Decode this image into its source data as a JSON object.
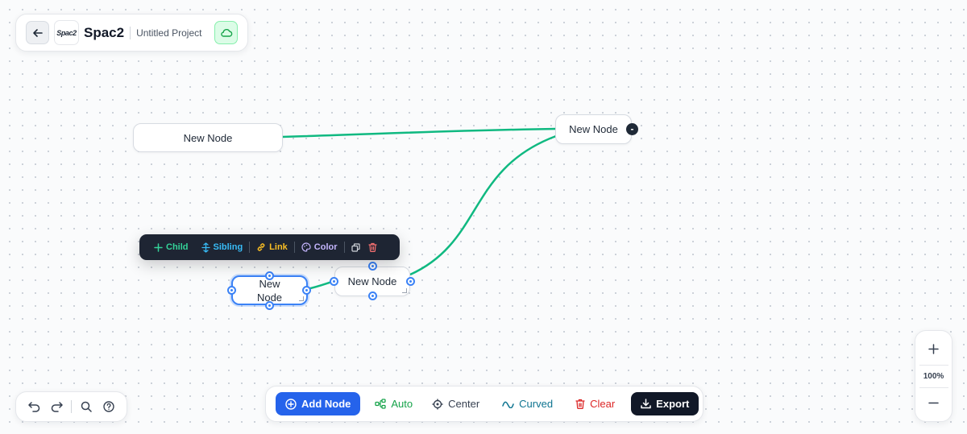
{
  "header": {
    "back_icon": "arrow-left-icon",
    "logo_text": "Spac2",
    "app_name": "Spac2",
    "project_name": "Untitled Project",
    "cloud_icon": "cloud-icon"
  },
  "nodes": [
    {
      "label": "New Node"
    },
    {
      "label": "New Node"
    },
    {
      "label": "New Node"
    },
    {
      "label": "New Node"
    }
  ],
  "collapse_label": "-",
  "context_toolbar": {
    "child": "Child",
    "sibling": "Sibling",
    "link": "Link",
    "color": "Color",
    "colors": {
      "child": "#34d399",
      "sibling": "#38bdf8",
      "link": "#fbbf24",
      "color": "#c4b5fd",
      "delete": "#f87171"
    }
  },
  "bottom_left": {
    "undo_icon": "undo-icon",
    "redo_icon": "redo-icon",
    "search_icon": "search-icon",
    "help_icon": "help-icon"
  },
  "toolbar": {
    "add_node": "Add Node",
    "auto": "Auto",
    "center": "Center",
    "curved": "Curved",
    "clear": "Clear",
    "export": "Export"
  },
  "zoom": {
    "level": "100%"
  },
  "colors": {
    "edge": "#10b981",
    "accent": "#2563eb",
    "selection": "#3b82f6"
  }
}
